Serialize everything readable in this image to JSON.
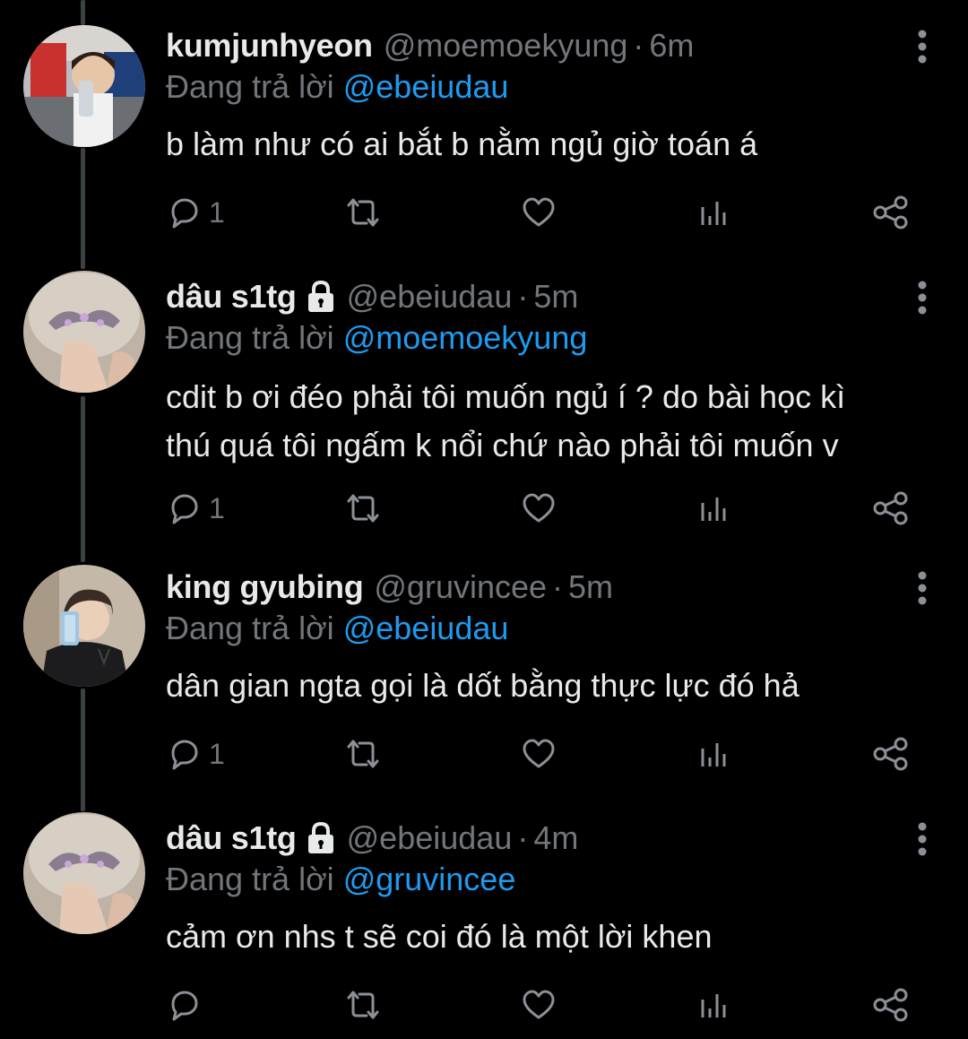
{
  "colors": {
    "background": "#000000",
    "text": "#e7e9ea",
    "muted": "#71767b",
    "mention": "#1d9bf0",
    "thread_line": "#3e4144"
  },
  "tweets": [
    {
      "display_name": "kumjunhyeon",
      "handle": "@moemoekyung",
      "separator": "·",
      "time": "6m",
      "locked": false,
      "reply_prefix": "Đang trả lời",
      "reply_to": "@ebeiudau",
      "text_lines": [
        "b làm như có ai bắt b nằm ngủ giờ toán á"
      ],
      "reply_count": "1",
      "avatar_icon": "user-avatar-photo"
    },
    {
      "display_name": "dâu s1tg",
      "handle": "@ebeiudau",
      "separator": "·",
      "time": "5m",
      "locked": true,
      "reply_prefix": "Đang trả lời",
      "reply_to": "@moemoekyung",
      "text_lines": [
        "cdit b ơi đéo phải tôi muốn ngủ í ? do bài học kì",
        "thú quá tôi ngấm k nổi chứ nào phải tôi muốn v"
      ],
      "reply_count": "1",
      "avatar_icon": "user-avatar-photo"
    },
    {
      "display_name": "king gyubing",
      "handle": "@gruvincee",
      "separator": "·",
      "time": "5m",
      "locked": false,
      "reply_prefix": "Đang trả lời",
      "reply_to": "@ebeiudau",
      "text_lines": [
        "dân gian ngta gọi là dốt bằng thực lực đó hả"
      ],
      "reply_count": "1",
      "avatar_icon": "user-avatar-photo"
    },
    {
      "display_name": "dâu s1tg",
      "handle": "@ebeiudau",
      "separator": "·",
      "time": "4m",
      "locked": true,
      "reply_prefix": "Đang trả lời",
      "reply_to": "@gruvincee",
      "text_lines": [
        "cảm ơn nhs t sẽ coi đó là một lời khen"
      ],
      "reply_count": "",
      "avatar_icon": "user-avatar-photo"
    }
  ],
  "action_icons": [
    "reply-icon",
    "retweet-icon",
    "like-icon",
    "views-icon",
    "share-icon"
  ]
}
